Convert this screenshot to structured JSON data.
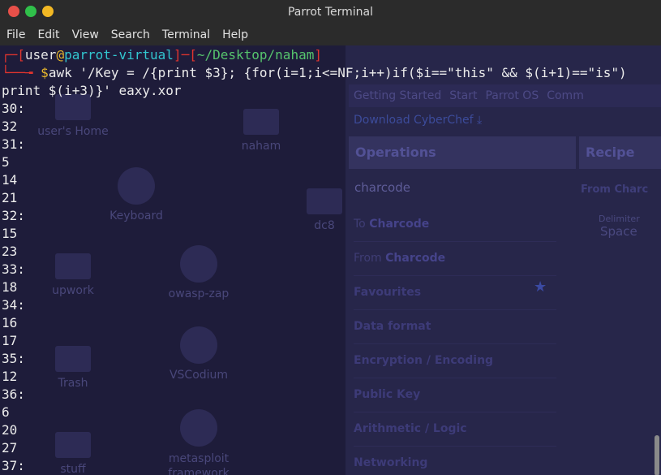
{
  "window": {
    "title": "Parrot Terminal",
    "menu": [
      "File",
      "Edit",
      "View",
      "Search",
      "Terminal",
      "Help"
    ]
  },
  "prompt": {
    "user": "user",
    "at": "@",
    "host": "parrot-virtual",
    "path": "~/Desktop/naham",
    "dollar": "$"
  },
  "command": {
    "line1": "awk '/Key = /{print $3}; {for(i=1;i<=NF;i++)if($i==\"this\" && $(i+1)==\"is\")",
    "line2": "print $(i+3)}' eaxy.xor"
  },
  "output": [
    "30:",
    "32",
    "31:",
    "5",
    "14",
    "21",
    "32:",
    "15",
    "23",
    "33:",
    "18",
    "34:",
    "16",
    "17",
    "35:",
    "12",
    "36:",
    "6",
    "20",
    "27",
    "37:"
  ],
  "background": {
    "browser_tabs": [
      "Getting Started",
      "Start",
      "Parrot OS",
      "Comm"
    ],
    "download_label": "Download CyberChef",
    "operations_title": "Operations",
    "recipe_title": "Recipe",
    "ops_search": "charcode",
    "ops_items": [
      {
        "prefix": "To ",
        "bold": "Charcode"
      },
      {
        "prefix": "From ",
        "bold": "Charcode"
      }
    ],
    "categories": [
      "Favourites",
      "Data format",
      "Encryption / Encoding",
      "Public Key",
      "Arithmetic / Logic",
      "Networking"
    ],
    "recipe_from": "From Charc",
    "recipe_delimiter_label": "Delimiter",
    "recipe_delimiter_value": "Space",
    "desktop_icons": [
      "user's Home",
      "Keyboard",
      "upwork",
      "owasp-zap",
      "Trash",
      "VSCodium",
      "stuff",
      "metasploit framework",
      "naham",
      "dc8"
    ]
  }
}
